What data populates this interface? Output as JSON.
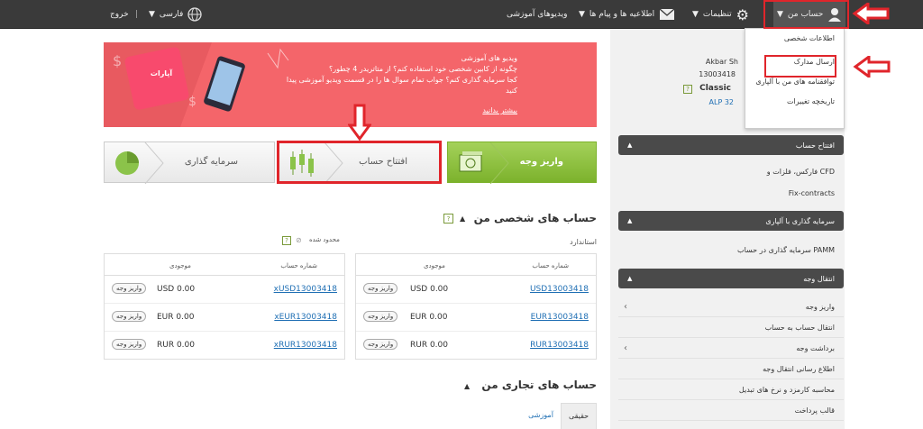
{
  "topbar": {
    "logout": "خروج",
    "language": "فارسی",
    "videos": "ویدیوهای آموزشی",
    "news": "اطلاعیه ها و پیام ها",
    "settings": "تنظیمات",
    "account": "حساب من"
  },
  "account_menu": [
    "اطلاعات شخصی",
    "ارسال مدارک",
    "توافقنامه های من با آلپاری",
    "تاریخچه تغییرات"
  ],
  "user": {
    "name": "Akbar Sh",
    "id": "13003418",
    "type": "Classic",
    "badge": "ALP 32"
  },
  "sidebar": {
    "open_account": "افتتاح حساب",
    "open_items": [
      "فارکس، فلزات و CFD",
      "Fix-contracts"
    ],
    "invest": "سرمایه گذاری با آلپاری",
    "invest_items": [
      "سرمایه گذاری در حساب PAMM"
    ],
    "transfer": "انتقال وجه",
    "transfer_items": [
      "واریز وجه",
      "انتقال حساب به حساب",
      "برداشت وجه",
      "اطلاع رسانی انتقال وجه",
      "محاسبه کارمزد و نرخ های تبدیل",
      "قالب پرداخت"
    ]
  },
  "banner": {
    "line1": "ویدیو های آموزشی",
    "line2": "چگونه از کابین شخصی خود استفاده کنم؟ از متاتریدر 4 چطور؟",
    "line3": "کجا سرمایه گذاری کنم؟ جواب تمام سوال ها را در قسمت ویدیو آموزشی پیدا کنید",
    "more": "بیشتر بدانید",
    "brand": "آپارات"
  },
  "actions": {
    "deposit": "واریز وجه",
    "open_account": "افتتاح حساب",
    "invest": "سرمایه گذاری"
  },
  "personal": {
    "title": "حساب های شخصی من",
    "standard": "استاندارد",
    "limited": "محدود شده",
    "col_account": "شماره حساب",
    "col_balance": "موجودی",
    "deposit_btn": "واریز وجه",
    "right_rows": [
      {
        "account": "USD13003418",
        "balance": "USD 0.00"
      },
      {
        "account": "EUR13003418",
        "balance": "EUR 0.00"
      },
      {
        "account": "RUR13003418",
        "balance": "RUR 0.00"
      }
    ],
    "left_rows": [
      {
        "account": "xUSD13003418",
        "balance": "USD 0.00"
      },
      {
        "account": "xEUR13003418",
        "balance": "EUR 0.00"
      },
      {
        "account": "xRUR13003418",
        "balance": "RUR 0.00"
      }
    ]
  },
  "trading": {
    "title": "حساب های تجاری من",
    "tab_real": "حقیقی",
    "tab_demo": "آموزشی"
  }
}
